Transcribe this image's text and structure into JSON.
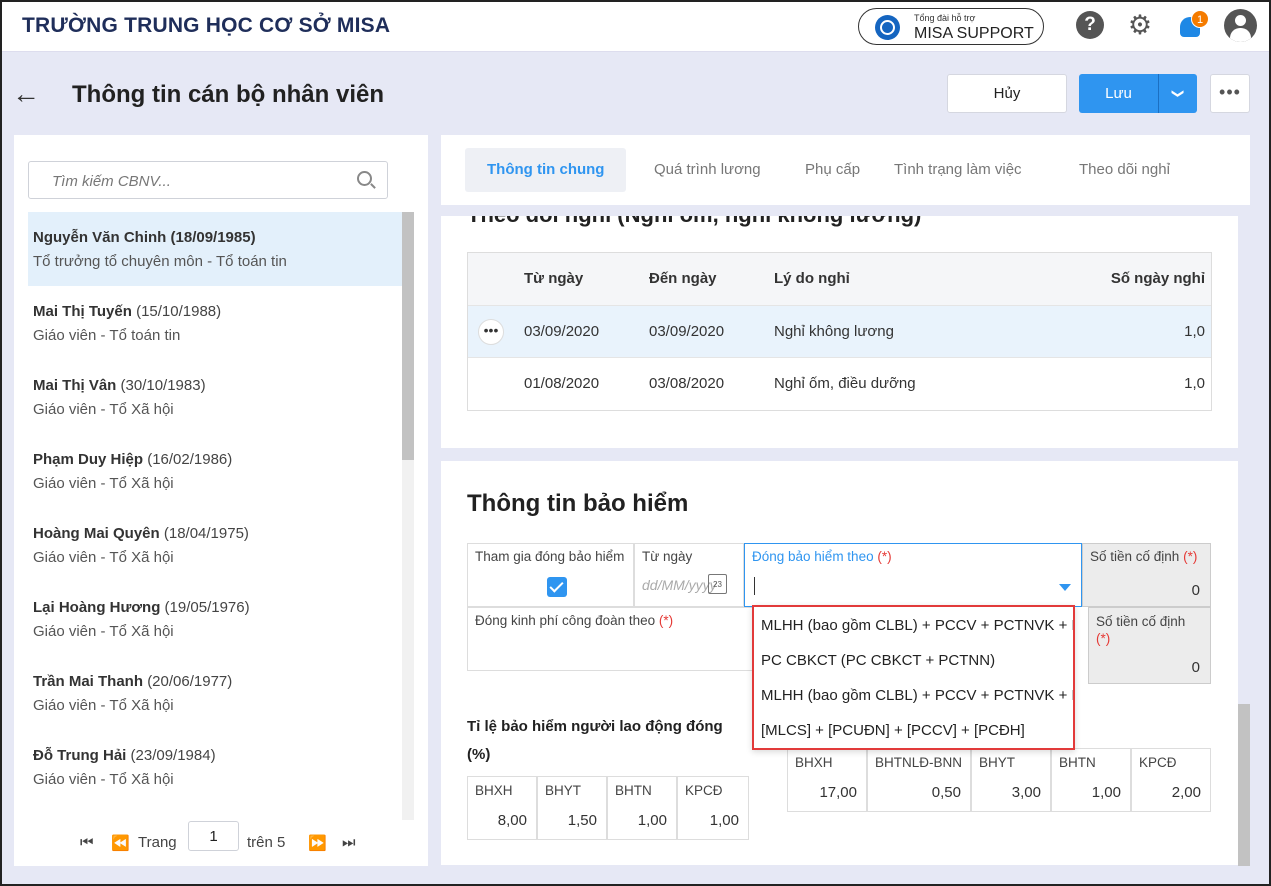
{
  "header": {
    "school": "TRƯỜNG TRUNG HỌC CƠ SỞ MISA",
    "support_line1": "Tổng đài hỗ trợ",
    "support_line2": "MISA SUPPORT",
    "help_glyph": "?",
    "gear_glyph": "⚙",
    "notif_count": "1"
  },
  "page": {
    "back_glyph": "←",
    "title": "Thông tin cán bộ nhân viên",
    "cancel": "Hủy",
    "save": "Lưu",
    "save_caret": "❯",
    "more": "•••"
  },
  "sidebar": {
    "search_placeholder": "Tìm kiếm CBNV...",
    "employees": [
      {
        "name": "Nguyễn Văn Chinh",
        "dob": "(18/09/1985)",
        "role": "Tổ trưởng tổ chuyên môn - Tổ toán tin"
      },
      {
        "name": "Mai Thị Tuyến",
        "dob": "(15/10/1988)",
        "role": "Giáo viên - Tổ toán tin"
      },
      {
        "name": "Mai Thị Vân",
        "dob": "(30/10/1983)",
        "role": "Giáo viên - Tổ Xã hội"
      },
      {
        "name": "Phạm Duy Hiệp",
        "dob": "(16/02/1986)",
        "role": "Giáo viên - Tổ Xã hội"
      },
      {
        "name": "Hoàng Mai Quyên",
        "dob": "(18/04/1975)",
        "role": "Giáo viên - Tổ Xã hội"
      },
      {
        "name": "Lại Hoàng Hương",
        "dob": "(19/05/1976)",
        "role": "Giáo viên - Tổ Xã hội"
      },
      {
        "name": "Trần Mai Thanh",
        "dob": "(20/06/1977)",
        "role": "Giáo viên - Tổ Xã hội"
      },
      {
        "name": "Đỗ Trung Hải",
        "dob": "(23/09/1984)",
        "role": "Giáo viên - Tổ Xã hội"
      }
    ],
    "pager": {
      "first": "⏮",
      "prev": "⏪",
      "page_label": "Trang",
      "page": "1",
      "of": "trên 5",
      "next": "⏩",
      "last": "⏭"
    }
  },
  "tabs": [
    "Thông tin chung",
    "Quá trình lương",
    "Phụ cấp",
    "Tình trạng làm việc",
    "Theo dõi nghỉ"
  ],
  "leave": {
    "section_title": "Theo dõi nghỉ (Nghỉ ốm, nghỉ không lương)",
    "headers": [
      "Từ ngày",
      "Đến ngày",
      "Lý do nghỉ",
      "Số ngày nghỉ"
    ],
    "row_action": "•••",
    "rows": [
      {
        "from": "03/09/2020",
        "to": "03/09/2020",
        "reason": "Nghỉ không lương",
        "days": "1,0"
      },
      {
        "from": "01/08/2020",
        "to": "03/08/2020",
        "reason": "Nghỉ ốm, điều dưỡng",
        "days": "1,0"
      }
    ]
  },
  "insurance": {
    "title": "Thông tin bảo hiểm",
    "join_label": "Tham gia đóng bảo hiểm",
    "from_label": "Từ ngày",
    "from_placeholder": "dd/MM/yyyy",
    "calendar_day": "23",
    "basis_label": "Đóng bảo hiểm theo",
    "required": "(*)",
    "fixed_label": "Số tiền cố định",
    "fixed_value": "0",
    "union_label": "Đóng kinh phí công đoàn theo",
    "fixed2_label": "Số tiền cố định",
    "fixed2_value": "0",
    "dropdown_options": [
      "MLHH (bao gồm CLBL) + PCCV + PCTNVK + PCTN",
      "PC CBKCT (PC CBKCT + PCTNN)",
      "MLHH (bao gồm CLBL) + PCCV + PCTNVK + PCTN",
      "[MLCS] + [PCUĐN] + [PCCV] + [PCĐH]"
    ],
    "employee_rate_title": "Tỉ lệ bảo hiểm người lao động đóng (%)",
    "employee_rates": [
      {
        "label": "BHXH",
        "value": "8,00"
      },
      {
        "label": "BHYT",
        "value": "1,50"
      },
      {
        "label": "BHTN",
        "value": "1,00"
      },
      {
        "label": "KPCĐ",
        "value": "1,00"
      }
    ],
    "employer_rates": [
      {
        "label": "BHXH",
        "value": "17,00"
      },
      {
        "label": "BHTNLĐ-BNN",
        "value": "0,50"
      },
      {
        "label": "BHYT",
        "value": "3,00"
      },
      {
        "label": "BHTN",
        "value": "1,00"
      },
      {
        "label": "KPCĐ",
        "value": "2,00"
      }
    ]
  },
  "colors": {
    "accent": "#2f95f0",
    "highlight": "#e9f3fc",
    "required": "#e53935",
    "dropdown_border": "#e23a3a"
  }
}
